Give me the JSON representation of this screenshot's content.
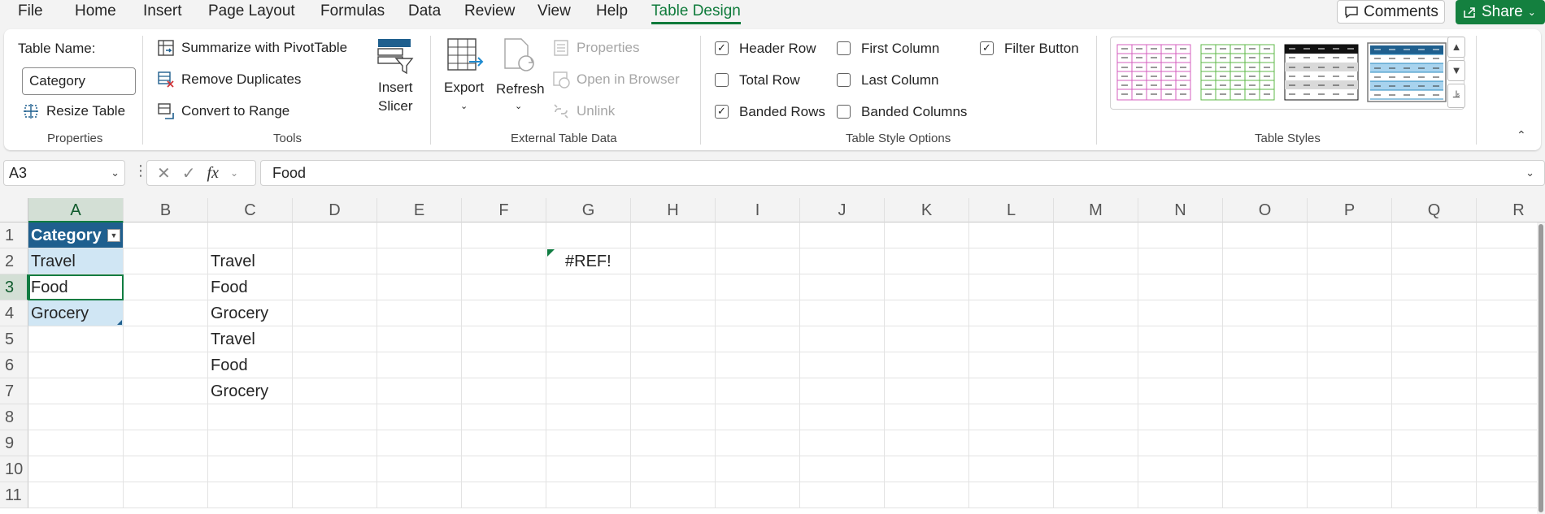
{
  "menu": {
    "items": [
      "File",
      "Home",
      "Insert",
      "Page Layout",
      "Formulas",
      "Data",
      "Review",
      "View",
      "Help",
      "Table Design"
    ],
    "active": "Table Design",
    "comments_label": "Comments",
    "share_label": "Share"
  },
  "ribbon": {
    "properties": {
      "table_name_label": "Table Name:",
      "table_name_value": "Category",
      "resize_label": "Resize Table",
      "group_label": "Properties"
    },
    "tools": {
      "summarize_label": "Summarize with PivotTable",
      "remove_dup_label": "Remove Duplicates",
      "convert_label": "Convert to Range",
      "insert_slicer_label_1": "Insert",
      "insert_slicer_label_2": "Slicer",
      "group_label": "Tools"
    },
    "external": {
      "export_label": "Export",
      "refresh_label": "Refresh",
      "properties_label": "Properties",
      "open_browser_label": "Open in Browser",
      "unlink_label": "Unlink",
      "group_label": "External Table Data"
    },
    "style_options": {
      "header_row": {
        "label": "Header Row",
        "checked": true
      },
      "total_row": {
        "label": "Total Row",
        "checked": false
      },
      "banded_rows": {
        "label": "Banded Rows",
        "checked": true
      },
      "first_column": {
        "label": "First Column",
        "checked": false
      },
      "last_column": {
        "label": "Last Column",
        "checked": false
      },
      "banded_columns": {
        "label": "Banded Columns",
        "checked": false
      },
      "filter_button": {
        "label": "Filter Button",
        "checked": true
      },
      "group_label": "Table Style Options"
    },
    "table_styles": {
      "group_label": "Table Styles",
      "thumbs": [
        {
          "name": "pink-style",
          "color": "#d45fbf"
        },
        {
          "name": "green-style",
          "color": "#5fb84a"
        },
        {
          "name": "black-style",
          "color": "#111111"
        },
        {
          "name": "blue-style",
          "color": "#2a8bc0"
        }
      ]
    }
  },
  "formula_bar": {
    "name_box": "A3",
    "fx_label": "fx",
    "value": "Food"
  },
  "sheet": {
    "columns": [
      "A",
      "B",
      "C",
      "D",
      "E",
      "F",
      "G",
      "H",
      "I",
      "J",
      "K",
      "L",
      "M",
      "N",
      "O",
      "P",
      "Q",
      "R"
    ],
    "rows": [
      "1",
      "2",
      "3",
      "4",
      "5",
      "6",
      "7",
      "8",
      "9",
      "10",
      "11"
    ],
    "cells": {
      "A1": "Category",
      "A2": "Travel",
      "A3": "Food",
      "A4": "Grocery",
      "C2": "Travel",
      "C3": "Food",
      "C4": "Grocery",
      "C5": "Travel",
      "C6": "Food",
      "C7": "Grocery",
      "G2": "#REF!"
    }
  },
  "colors": {
    "accent": "#107c41",
    "table_header": "#1f5f8e",
    "table_band": "#d0e6f4"
  }
}
